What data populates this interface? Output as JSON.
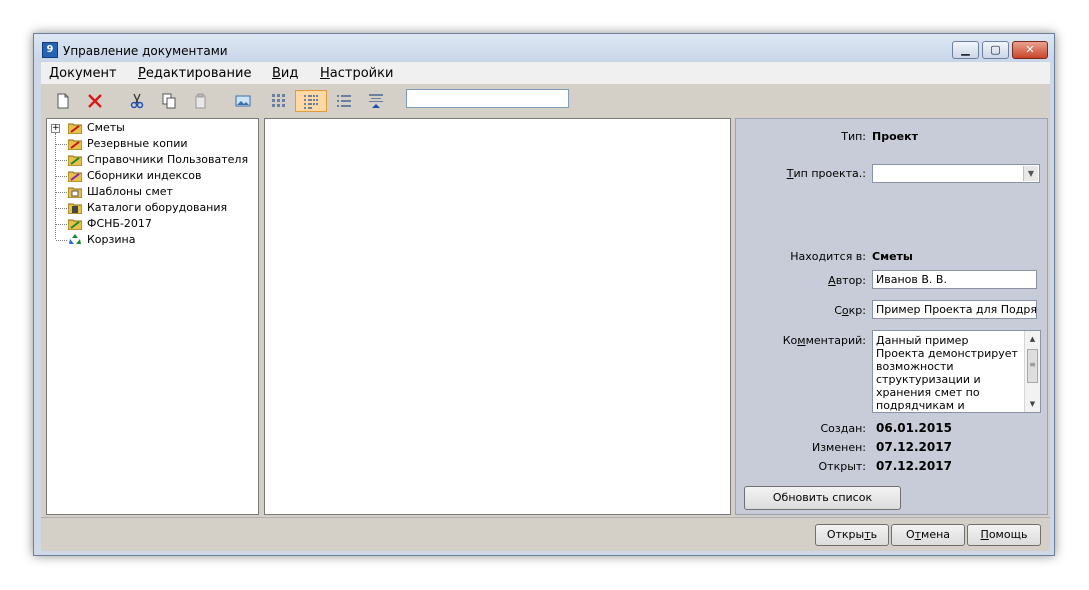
{
  "window": {
    "title": "Управление документами",
    "icon_glyph": "9",
    "controls": {
      "minimize": "▁",
      "maximize": "▢",
      "close": "✕"
    }
  },
  "menu": [
    {
      "label": "Документ",
      "accel": "Д",
      "rest": "окумент"
    },
    {
      "label": "Редактирование",
      "accel": "Р",
      "rest": "едактирование"
    },
    {
      "label": "Вид",
      "accel": "В",
      "rest": "ид"
    },
    {
      "label": "Настройки",
      "accel": "Н",
      "rest": "астройки"
    }
  ],
  "toolbar": {
    "buttons": [
      "new-document-icon",
      "delete-icon",
      "cut-icon",
      "copy-icon",
      "paste-icon",
      "image-icon",
      "large-icons-view-icon",
      "small-icons-view-icon",
      "list-view-icon",
      "details-view-icon"
    ],
    "active_view": "small-icons-view-icon",
    "search_value": ""
  },
  "tree": {
    "items": [
      {
        "label": "Сметы",
        "icon": "folder-estimates-icon",
        "expandable": true
      },
      {
        "label": "Резервные копии",
        "icon": "folder-backup-icon"
      },
      {
        "label": "Справочники Пользователя",
        "icon": "folder-user-reference-icon"
      },
      {
        "label": "Сборники индексов",
        "icon": "folder-index-collections-icon"
      },
      {
        "label": "Шаблоны смет",
        "icon": "folder-templates-icon"
      },
      {
        "label": "Каталоги оборудования",
        "icon": "folder-equipment-catalog-icon"
      },
      {
        "label": "ФСНБ-2017",
        "icon": "folder-fsnb-icon"
      },
      {
        "label": "Корзина",
        "icon": "recycle-bin-icon"
      }
    ]
  },
  "props": {
    "type_label": "Тип:",
    "type_value": "Проект",
    "project_type_label": "Тип проекта.:",
    "project_type_accel": "Т",
    "project_type_rest": "ип проекта.:",
    "project_type_value": "",
    "location_label": "Находится в:",
    "location_value": "Сметы",
    "author_label": "Автор:",
    "author_accel": "А",
    "author_rest": "втор:",
    "author_value": "Иванов В. В.",
    "short_label": "Сокр:",
    "short_pre": "С",
    "short_accel": "о",
    "short_rest": "кр:",
    "short_value": "Пример Проекта для Подряд",
    "comment_label": "Комментарий:",
    "comment_pre": "Ко",
    "comment_accel": "м",
    "comment_rest": "ментарий:",
    "comment_value": "Данный пример Проекта демонстрирует возможности структуризации и хранения смет по подрядчикам и",
    "created_label": "Создан:",
    "created_value": "06.01.2015",
    "modified_label": "Изменен:",
    "modified_value": "07.12.2017",
    "opened_label": "Открыт:",
    "opened_value": "07.12.2017",
    "refresh_button": "Обновить список"
  },
  "footer": {
    "open_pre": "Откры",
    "open_accel": "т",
    "open_rest": "ь",
    "cancel_pre": "О",
    "cancel_accel": "т",
    "cancel_rest": "мена",
    "help_accel": "П",
    "help_rest": "омощь"
  },
  "colors": {
    "accent": "#e59a3a",
    "panel": "#c7ccd8",
    "window_frame": "#cfd8e6"
  }
}
